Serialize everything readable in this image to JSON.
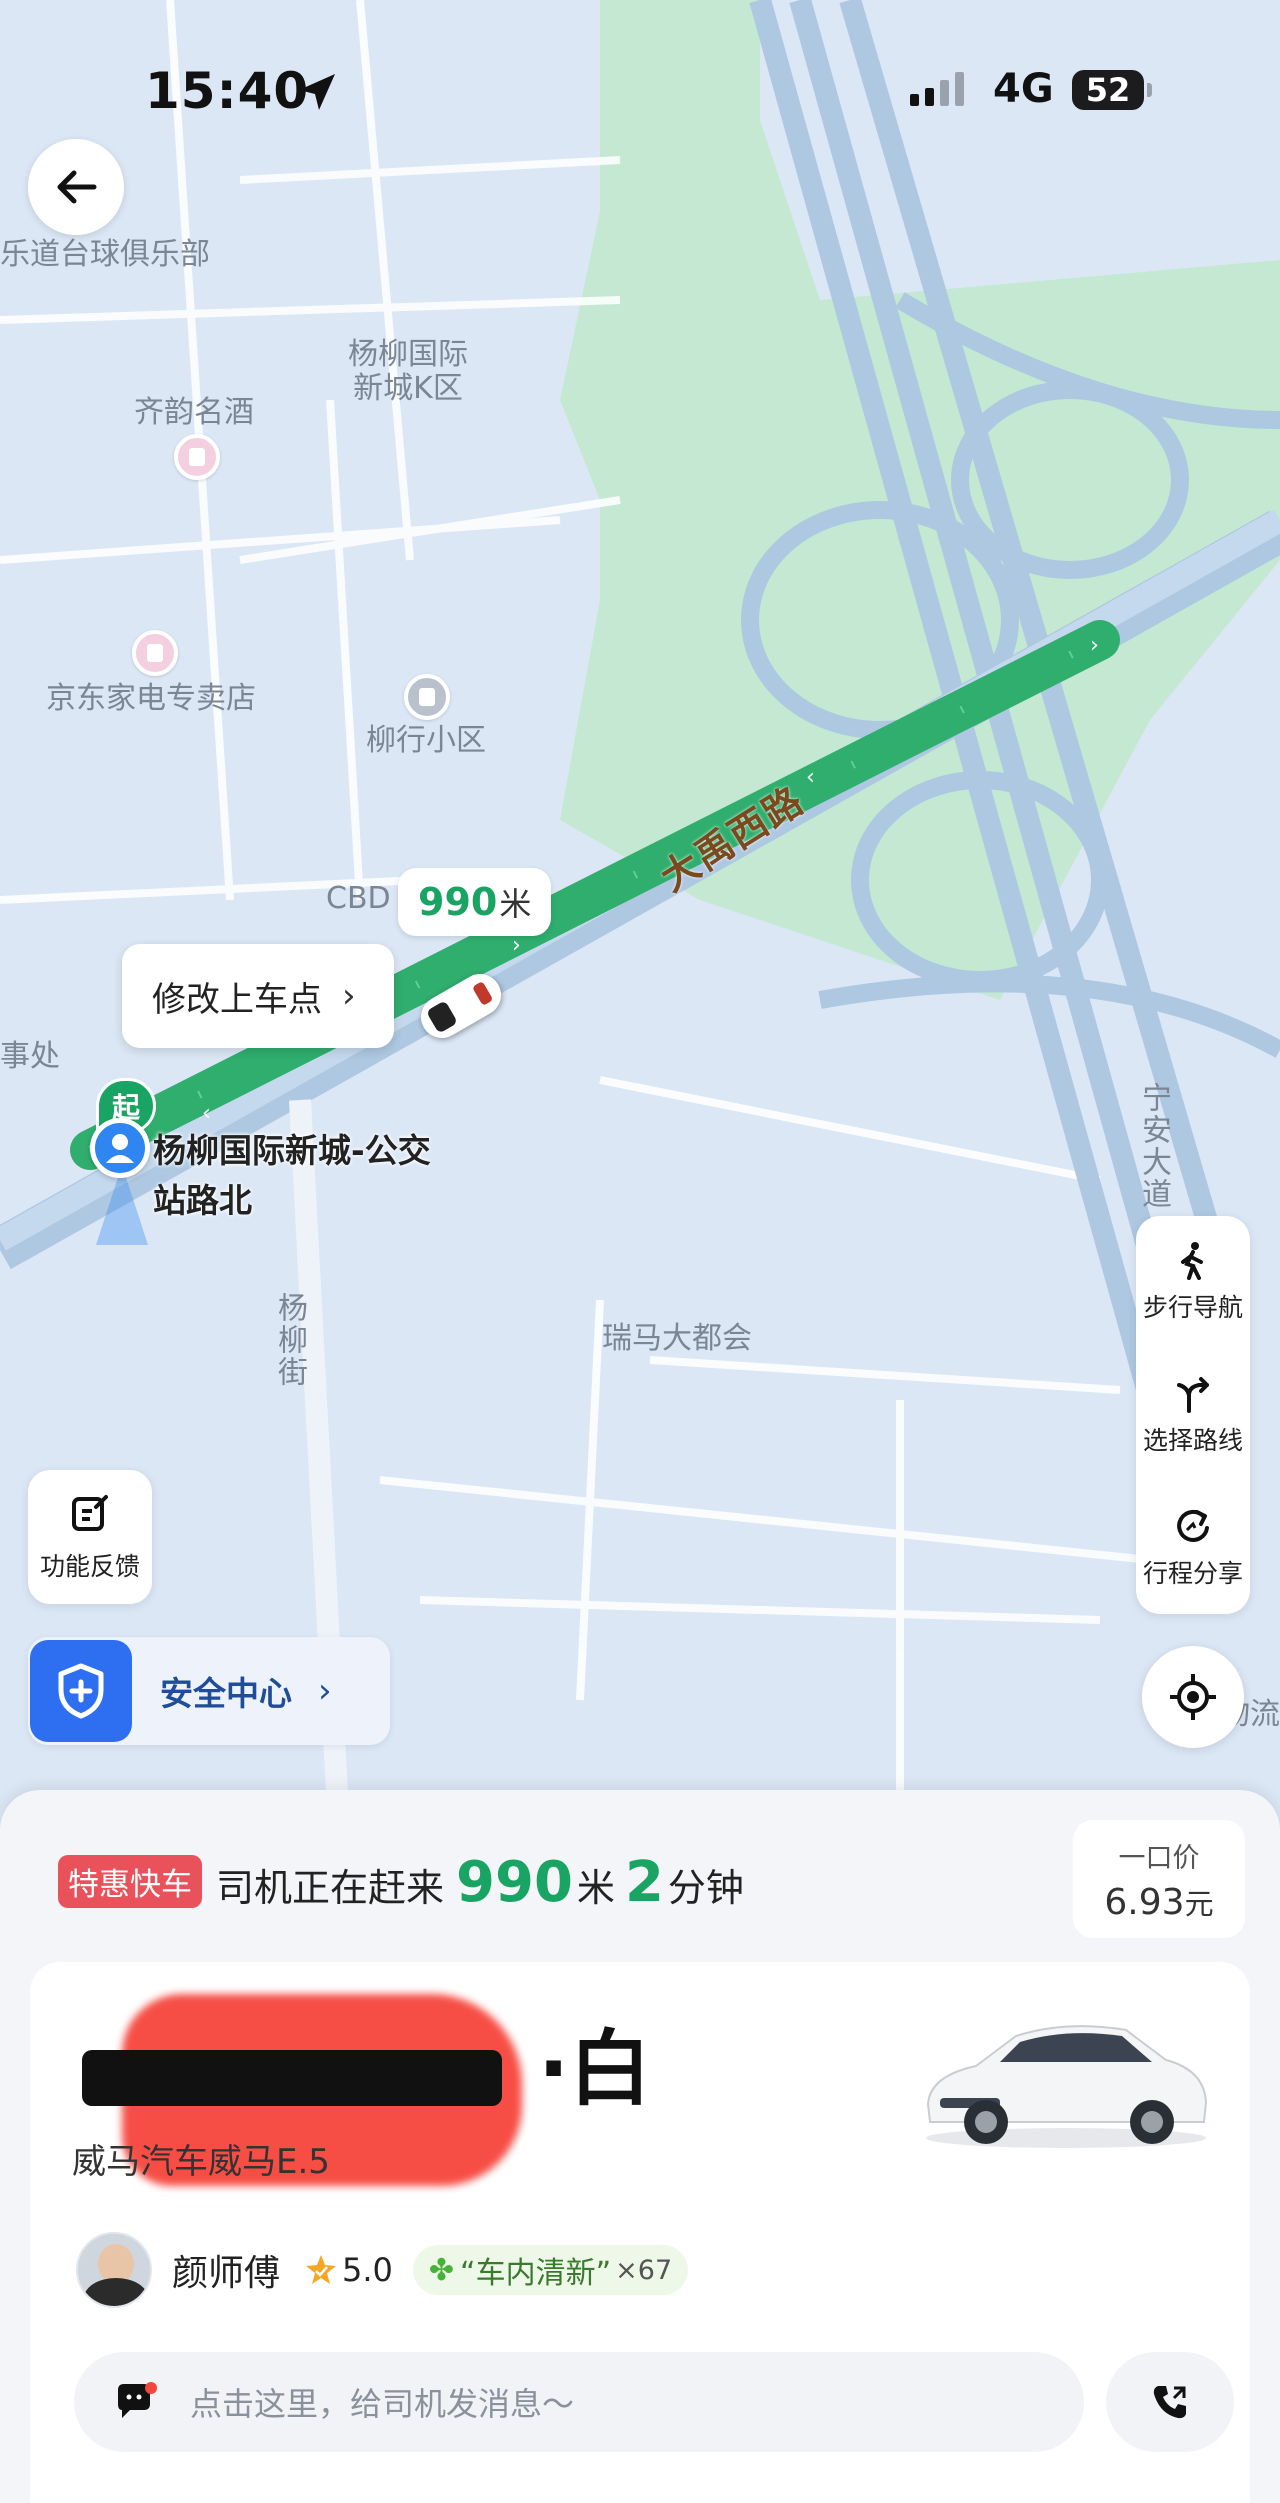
{
  "status_bar": {
    "time": "15:40",
    "network": "4G",
    "battery": "52"
  },
  "map": {
    "labels": {
      "billiards": "乐道台球俱乐部",
      "yangliu_k": "杨柳国际\n新城K区",
      "qiyun": "齐韵名酒",
      "jd_store": "京东家电专卖店",
      "liuxing": "柳行小区",
      "cbd": "CBD",
      "office": "事处",
      "yangliu_street": "杨柳街",
      "ruima": "瑞马大都会",
      "ningan": "宁安大道",
      "wuliu": "物流"
    },
    "road_name": "大禹西路",
    "distance": {
      "value": "990",
      "unit": "米"
    },
    "modify_pickup": "修改上车点",
    "start_badge": "起",
    "pickup_label": "杨柳国际新城-公交站路北"
  },
  "tools": {
    "walk_nav": "步行导航",
    "choose_route": "选择路线",
    "share_trip": "行程分享"
  },
  "feedback": "功能反馈",
  "safety_center": "安全中心",
  "sheet": {
    "tag": "特惠快车",
    "eta_prefix": "司机正在赶来",
    "eta_distance": "990",
    "eta_distance_unit": "米",
    "eta_minutes": "2",
    "eta_minutes_unit": "分钟",
    "price_label": "一口价",
    "price_value": "6.93",
    "price_unit": "元",
    "plate_suffix": "·白",
    "car_model": "威马汽车威马E.5",
    "driver_name": "颜师傅",
    "rating": "5.0",
    "fresh_tag": "“车内清新”",
    "fresh_count": "×67",
    "message_placeholder": "点击这里，给司机发消息～"
  },
  "colors": {
    "accent_green": "#1aa463",
    "tag_red": "#e9525b",
    "safety_blue": "#2d6ff0"
  }
}
